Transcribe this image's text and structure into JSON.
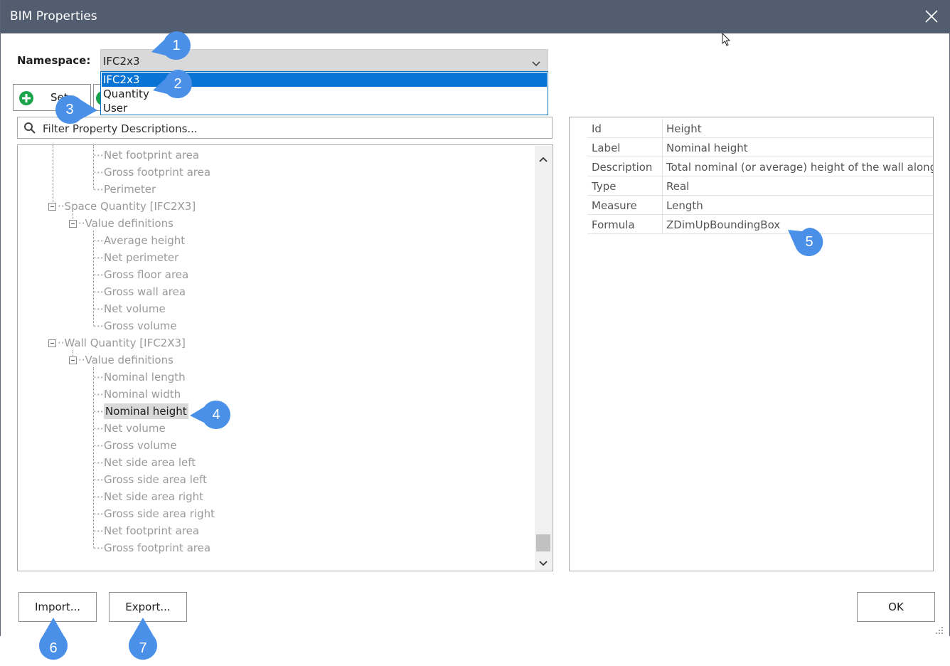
{
  "window": {
    "title": "BIM Properties"
  },
  "namespace": {
    "label": "Namespace:",
    "selected": "IFC2x3",
    "options": [
      "IFC2x3",
      "Quantity",
      "User"
    ]
  },
  "toolbar": {
    "set_button_label": "Set"
  },
  "filter": {
    "placeholder": "Filter Property Descriptions..."
  },
  "tree": {
    "items": [
      {
        "label": "Net footprint area"
      },
      {
        "label": "Gross footprint area"
      },
      {
        "label": "Perimeter"
      },
      {
        "label": "Space Quantity [IFC2X3]"
      },
      {
        "label": "Value definitions"
      },
      {
        "label": "Average height"
      },
      {
        "label": "Net perimeter"
      },
      {
        "label": "Gross floor area"
      },
      {
        "label": "Gross wall area"
      },
      {
        "label": "Net volume"
      },
      {
        "label": "Gross volume"
      },
      {
        "label": "Wall Quantity [IFC2X3]"
      },
      {
        "label": "Value definitions"
      },
      {
        "label": "Nominal length"
      },
      {
        "label": "Nominal width"
      },
      {
        "label": "Nominal height"
      },
      {
        "label": "Net volume"
      },
      {
        "label": "Gross volume"
      },
      {
        "label": "Net side area left"
      },
      {
        "label": "Gross side area left"
      },
      {
        "label": "Net side area right"
      },
      {
        "label": "Gross side area right"
      },
      {
        "label": "Net footprint area"
      },
      {
        "label": "Gross footprint area"
      }
    ],
    "selected": "Nominal height"
  },
  "properties": [
    {
      "key": "Id",
      "value": "Height"
    },
    {
      "key": "Label",
      "value": "Nominal height"
    },
    {
      "key": "Description",
      "value": "Total nominal (or average) height of the wall along t"
    },
    {
      "key": "Type",
      "value": "Real"
    },
    {
      "key": "Measure",
      "value": "Length"
    },
    {
      "key": "Formula",
      "value": "ZDimUpBoundingBox"
    }
  ],
  "buttons": {
    "import": "Import...",
    "export": "Export...",
    "ok": "OK"
  },
  "callouts": [
    "1",
    "2",
    "3",
    "4",
    "5",
    "6",
    "7"
  ],
  "colors": {
    "titlebar": "#525e6f",
    "selection": "#0a74d4",
    "callout": "#4a90e8",
    "plus_icon": "#1aa34a"
  }
}
